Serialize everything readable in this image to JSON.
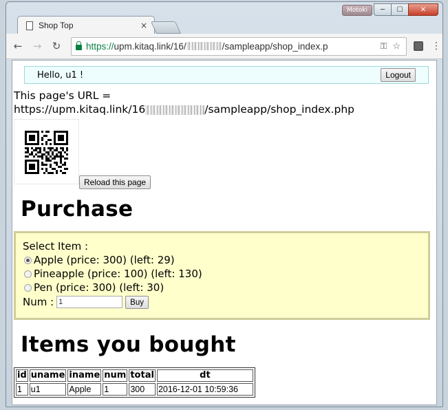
{
  "browser": {
    "user_badge": "Motoki",
    "tab_title": "Shop Top",
    "tab_close": "×",
    "url_scheme": "https://",
    "url_rest": "upm.kitaq.link/16/",
    "url_tail": "/sampleapp/shop_index.p",
    "window_min": "─",
    "window_max": "☐",
    "window_close": "✕"
  },
  "page": {
    "hello_text": "Hello, u1 !",
    "logout_label": "Logout",
    "url_label": "This page's URL =",
    "url_prefix": "https://upm.kitaq.link/16",
    "url_suffix": "/sampleapp/shop_index.php",
    "reload_label": "Reload this page",
    "purchase_heading": "Purchase",
    "select_label": "Select Item :",
    "options": [
      {
        "label": "Apple (price: 300) (left: 29)",
        "checked": true
      },
      {
        "label": "Pineapple (price: 100) (left: 130)",
        "checked": false
      },
      {
        "label": "Pen (price: 300) (left: 30)",
        "checked": false
      }
    ],
    "num_label": "Num :",
    "num_value": "1",
    "buy_label": "Buy",
    "items_heading": "Items you bought",
    "table": {
      "headers": [
        "id",
        "uname",
        "iname",
        "num",
        "total",
        "dt"
      ],
      "rows": [
        [
          "1",
          "u1",
          "Apple",
          "1",
          "300",
          "2016-12-01 10:59:36"
        ]
      ]
    }
  }
}
